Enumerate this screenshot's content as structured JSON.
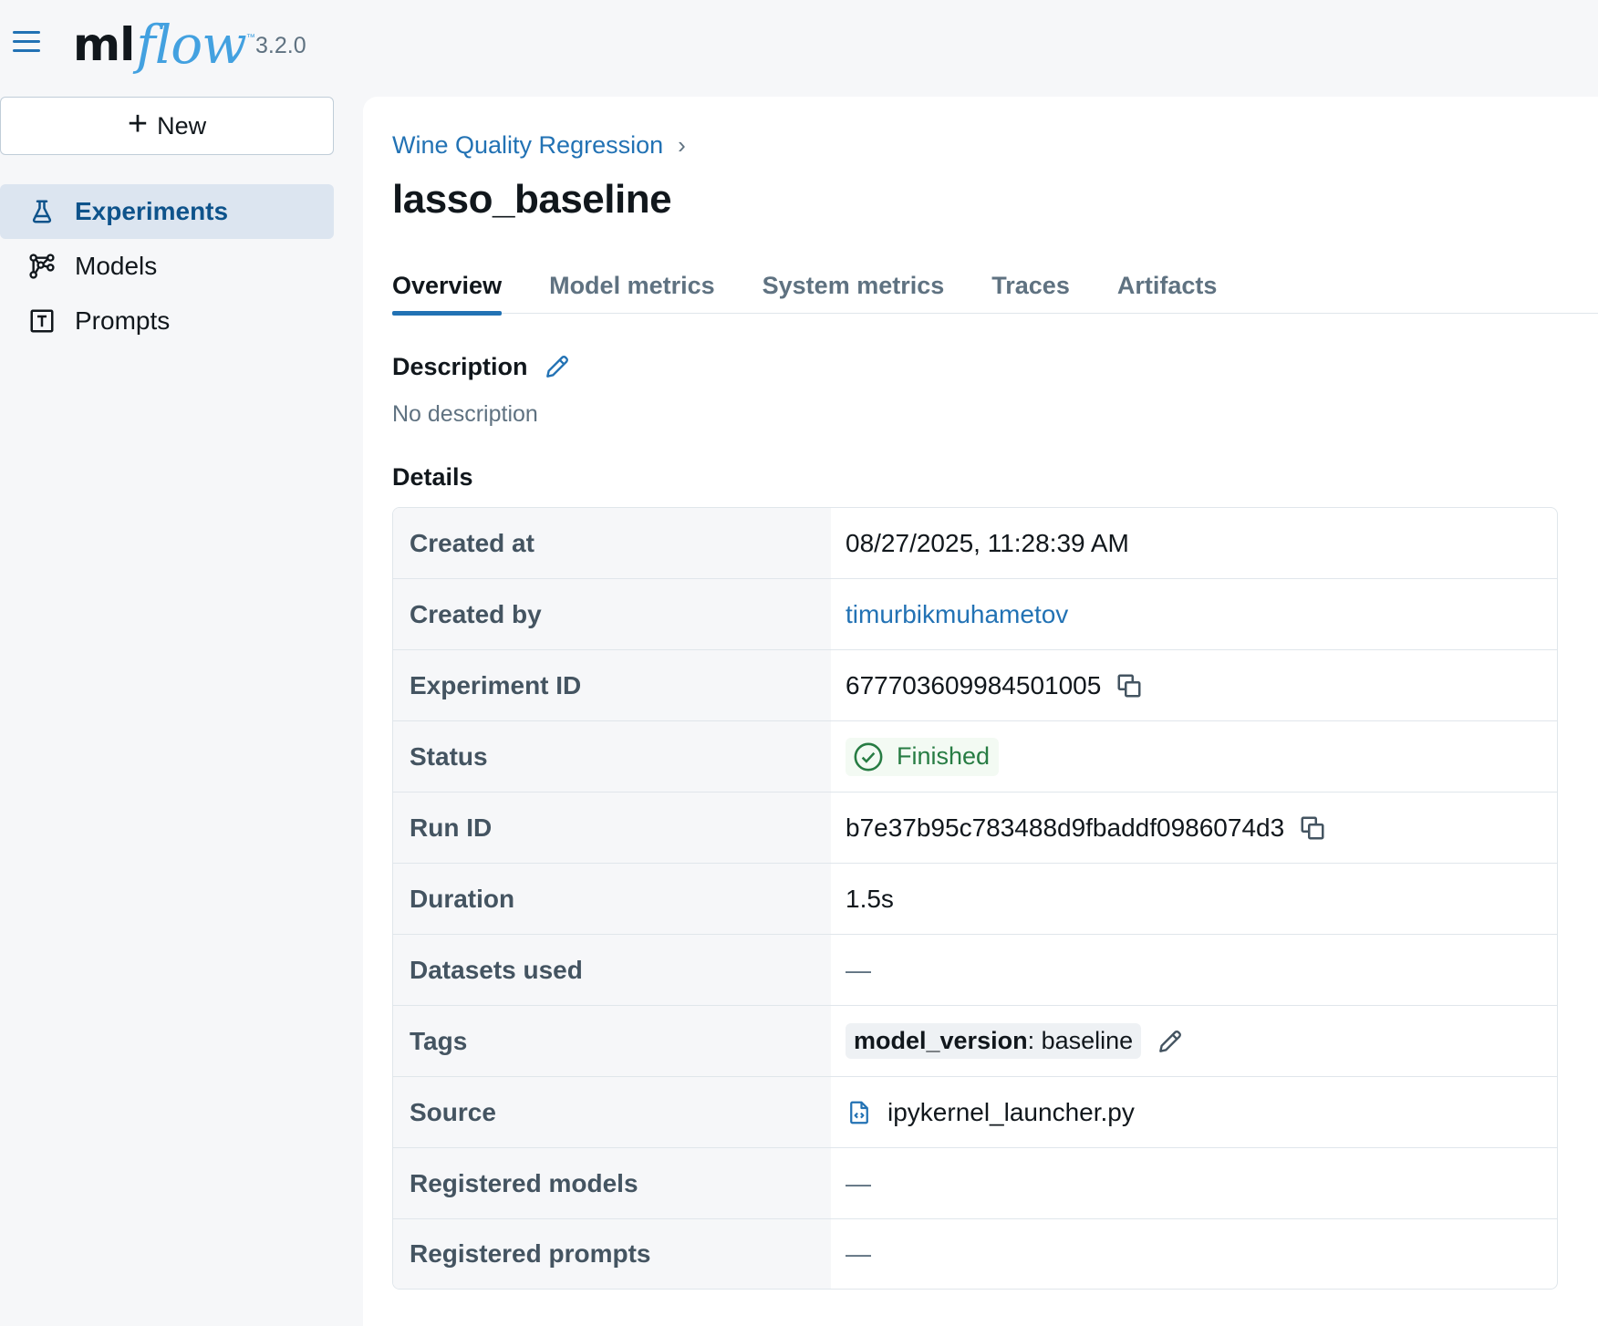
{
  "header": {
    "logo_ml": "ml",
    "logo_flow": "flow",
    "logo_tm": "™",
    "version": "3.2.0"
  },
  "sidebar": {
    "new_label": "New",
    "items": [
      {
        "label": "Experiments",
        "icon": "flask-icon",
        "active": true
      },
      {
        "label": "Models",
        "icon": "models-icon",
        "active": false
      },
      {
        "label": "Prompts",
        "icon": "prompts-icon",
        "active": false
      }
    ]
  },
  "main": {
    "breadcrumb": "Wine Quality Regression",
    "breadcrumb_chevron": "›",
    "title": "lasso_baseline",
    "tabs": [
      "Overview",
      "Model metrics",
      "System metrics",
      "Traces",
      "Artifacts"
    ],
    "active_tab": "Overview",
    "description_label": "Description",
    "description_text": "No description",
    "details_label": "Details"
  },
  "details": {
    "created_at": {
      "key": "Created at",
      "value": "08/27/2025, 11:28:39 AM"
    },
    "created_by": {
      "key": "Created by",
      "value": "timurbikmuhametov"
    },
    "experiment_id": {
      "key": "Experiment ID",
      "value": "677703609984501005"
    },
    "status": {
      "key": "Status",
      "value": "Finished"
    },
    "run_id": {
      "key": "Run ID",
      "value": "b7e37b95c783488d9fbaddf0986074d3"
    },
    "duration": {
      "key": "Duration",
      "value": "1.5s"
    },
    "datasets": {
      "key": "Datasets used",
      "value": "—"
    },
    "tags": {
      "key": "Tags",
      "tag_key": "model_version",
      "tag_sep": ": ",
      "tag_value": "baseline"
    },
    "source": {
      "key": "Source",
      "value": "ipykernel_launcher.py"
    },
    "registered_models": {
      "key": "Registered models",
      "value": "—"
    },
    "registered_prompts": {
      "key": "Registered prompts",
      "value": "—"
    }
  },
  "colors": {
    "accent": "#2272b4",
    "success": "#277c43",
    "logo_blue": "#43a1e0"
  }
}
